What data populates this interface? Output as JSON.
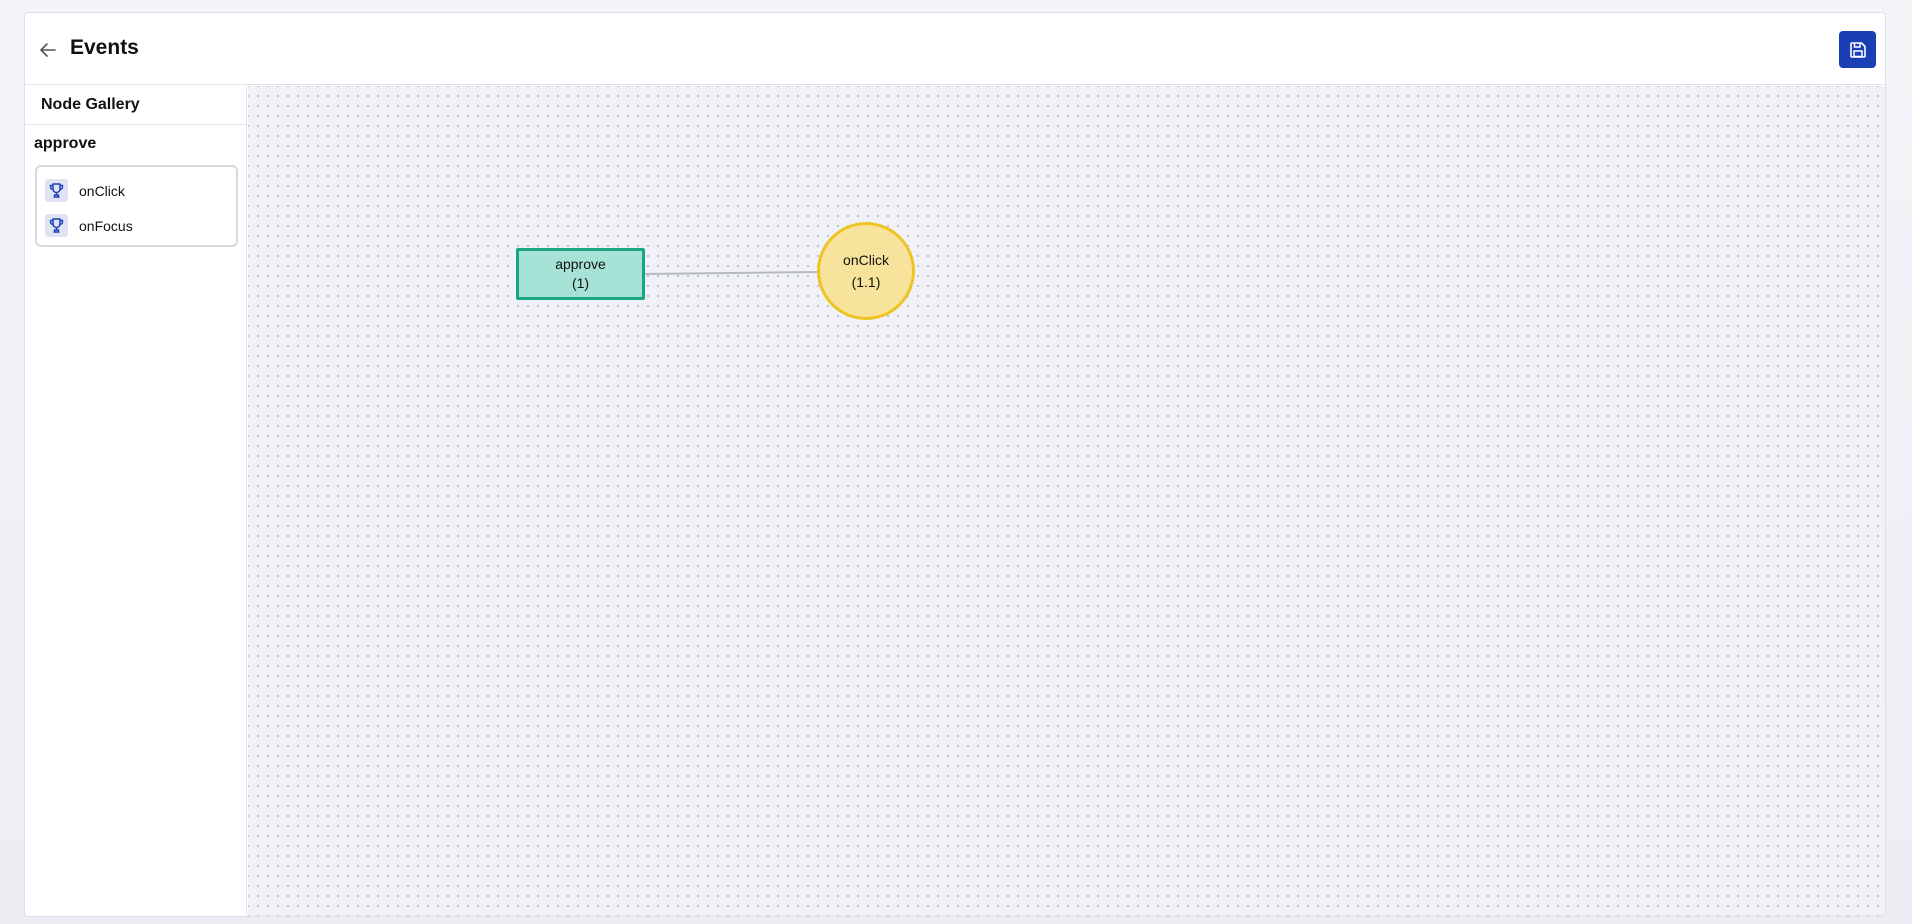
{
  "header": {
    "title": "Events",
    "back_icon": "arrow-left-icon",
    "save_icon": "save-icon",
    "accent_color": "#1a3fb4"
  },
  "sidebar": {
    "title": "Node Gallery",
    "group": {
      "title": "approve",
      "items": [
        {
          "label": "onClick",
          "icon": "trophy-icon"
        },
        {
          "label": "onFocus",
          "icon": "trophy-icon"
        }
      ]
    }
  },
  "canvas": {
    "background": "#f1f2f8",
    "nodes": [
      {
        "label": "approve",
        "index": "(1)",
        "shape": "rectangle",
        "fill": "#a6e3d6",
        "stroke": "#1ca584"
      },
      {
        "label": "onClick",
        "index": "(1.1)",
        "shape": "circle",
        "fill": "#f7e39c",
        "stroke": "#eec424"
      }
    ],
    "edges": [
      {
        "from": "approve",
        "to": "onClick"
      }
    ]
  }
}
